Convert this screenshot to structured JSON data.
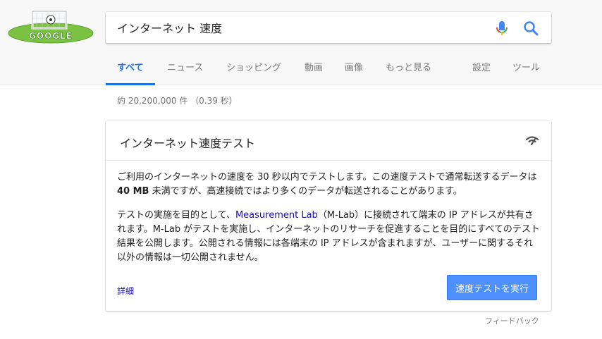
{
  "doodle": {
    "lettering": "GOOGLE"
  },
  "search": {
    "query": "インターネット 速度"
  },
  "tabs": [
    {
      "label": "すべて"
    },
    {
      "label": "ニュース"
    },
    {
      "label": "ショッピング"
    },
    {
      "label": "動画"
    },
    {
      "label": "画像"
    },
    {
      "label": "もっと見る"
    },
    {
      "label": "設定"
    },
    {
      "label": "ツール"
    }
  ],
  "stats": "約 20,200,000 件 （0.39 秒）",
  "card": {
    "title": "インターネット速度テスト",
    "p1_before": "ご利用のインターネットの速度を 30 秒以内でテストします。この速度テストで通常転送するデータは ",
    "p1_bold": "40 MB",
    "p1_after": " 未満ですが、高速接続ではより多くのデータが転送されることがあります。",
    "p2_before": "テストの実施を目的として、",
    "p2_link": "Measurement Lab",
    "p2_after": "（M-Lab）に接続されて端末の IP アドレスが共有されます。M-Lab がテストを実施し、インターネットのリサーチを促進することを目的にすべてのテスト結果を公開します。公開される情報には各端末の IP アドレスが含まれますが、ユーザーに関するそれ以外の情報は一切公開されません。",
    "more_link": "詳細",
    "run_button": "速度テストを実行"
  },
  "feedback": "フィードバック",
  "colors": {
    "accent": "#1a73e8",
    "link": "#1a0dab",
    "button": "#4d90fe"
  },
  "icons": [
    "google-doodle-logo",
    "mic-icon",
    "search-icon",
    "speed-icon"
  ]
}
